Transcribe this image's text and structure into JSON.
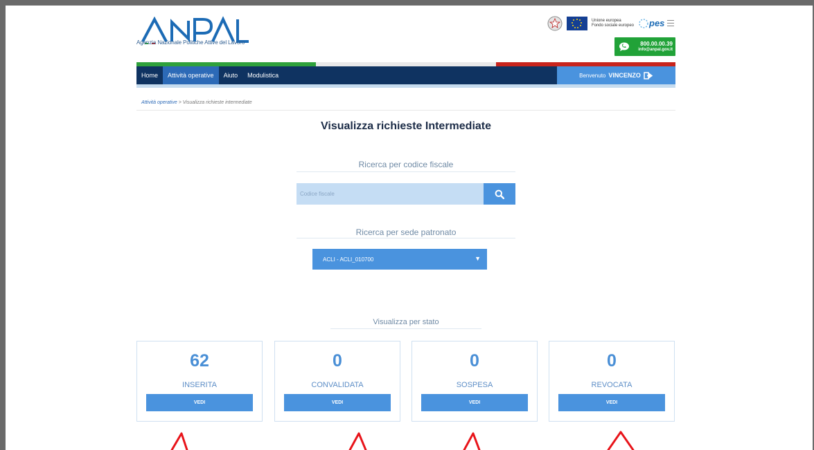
{
  "header": {
    "logo_text": "ANPAL",
    "logo_subtitle": "Agenzia Nazionale Politiche Attive del Lavoro",
    "eu_text": "Unione europea\nFondo sociale europeo",
    "pes_text": "pes",
    "phone": "800.00.00.39",
    "email": "info@anpal.gov.it"
  },
  "nav": {
    "items": [
      {
        "label": "Home",
        "active": false
      },
      {
        "label": "Attività operative",
        "active": true
      },
      {
        "label": "Aiuto",
        "active": false
      },
      {
        "label": "Modulistica",
        "active": false
      }
    ],
    "welcome": "Benvenuto",
    "user": "VINCENZO"
  },
  "breadcrumb": {
    "parent": "Attività operative",
    "separator": ">",
    "current": "Visualizza richieste intermediate"
  },
  "page_title": "Visualizza richieste Intermediate",
  "search_cf": {
    "label": "Ricerca per codice fiscale",
    "placeholder": "Codice fiscale"
  },
  "search_sede": {
    "label": "Ricerca per sede patronato",
    "selected": "ACLI - ACLI_010700"
  },
  "stato": {
    "label": "Visualizza per stato",
    "cards": [
      {
        "count": "62",
        "label": "INSERITA",
        "button": "VEDI"
      },
      {
        "count": "0",
        "label": "CONVALIDATA",
        "button": "VEDI"
      },
      {
        "count": "0",
        "label": "SOSPESA",
        "button": "VEDI"
      },
      {
        "count": "0",
        "label": "REVOCATA",
        "button": "VEDI"
      }
    ]
  },
  "colors": {
    "navbar": "#0f3361",
    "accent": "#4a93de",
    "flag_green": "#2fa13b",
    "flag_red": "#c8241c",
    "annotation_arrow": "#e8141a"
  }
}
